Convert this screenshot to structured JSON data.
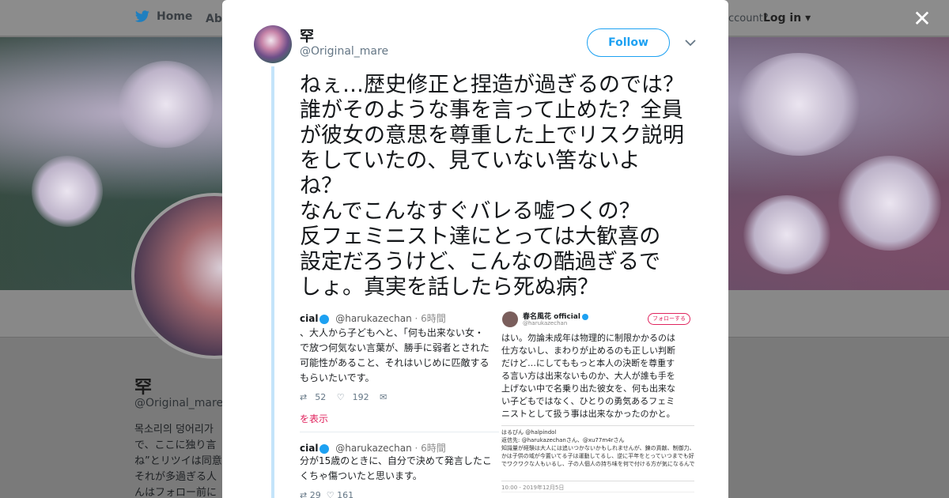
{
  "nav": {
    "home_label": "Home",
    "about_label": "Abo",
    "account_text": "ccount?",
    "login_label": "Log in"
  },
  "background_profile": {
    "name": "罕",
    "handle": "@Original_mare",
    "bio_lines": [
      "목소리의 덩어리가",
      "で、ここに独り言",
      "ね”とリツイは同意",
      "それが多過ぎる人",
      "んはフォロー前に"
    ]
  },
  "close_icon": "close-icon",
  "tweet": {
    "author_name": "罕",
    "author_handle": "@Original_mare",
    "follow_label": "Follow",
    "text": "ねぇ…歴史修正と捏造が過ぎるのでは？\n誰がそのような事を言って止めた？全員\nが彼女の意思を尊重した上でリスク説明\nをしていたの、見ていない筈ないよ\nね？\nなんでこんなすぐバレる嘘つくの？\n反フェミニスト達にとっては大歓喜の\n設定だろうけど、こんなの酷過ぎるで\nしょ。真実を話したら死ぬ病？"
  },
  "media": {
    "left": {
      "header_name": "cial",
      "header_handle": "@harukazechan",
      "header_time": "· 6時間",
      "body": "、大人から子どもへと、「何も出来ない女・\nで放つ何気ない言葉が、勝手に弱者とされた\n可能性があること、それはいじめに匹敵する\nもらいたいです。",
      "retweets": "52",
      "likes": "192",
      "show_more": "を表示",
      "header2_name": "cial",
      "header2_handle": "@harukazechan",
      "header2_time": "· 6時間",
      "body2": "分が15歳のときに、自分で決めて発言したこ\nくちゃ傷ついたと思います。",
      "retweets2": "29",
      "likes2": "161"
    },
    "right": {
      "name": "春名風花 official",
      "handle": "@harukazechan",
      "follow_label": "フォローする",
      "body": "はい。勿論未成年は物理的に制限かかるのは\n仕方ないし、まわりが止めるのも正しい判断\nだけど…にしてももっと本人の決断を尊重す\nる言い方は出来ないものか、大人が誰も手を\n上げない中で名乗り出た彼女を、何も出来な\nい子どもではなく、ひとりの勇気あるフェミ\nニストとして扱う事は出来なかったのかと。",
      "card_text": "はるぴん @halpindol\n返信先: @harukazechanさん、@xu77m4rさん\n知識量が経験は大人には追いつかないかもしれませんが、錬の貢献、制御力、発想力などん\nかは子供の域が今置いてる子は運動してるし、逆に平年をとっていつまでも好奇心旺盛\nでワクワクな人もいるし、子の人個人の持ち味を何で付ける方が気になるんです。",
      "timestamp": "10:00 - 2019年12月5日"
    }
  }
}
